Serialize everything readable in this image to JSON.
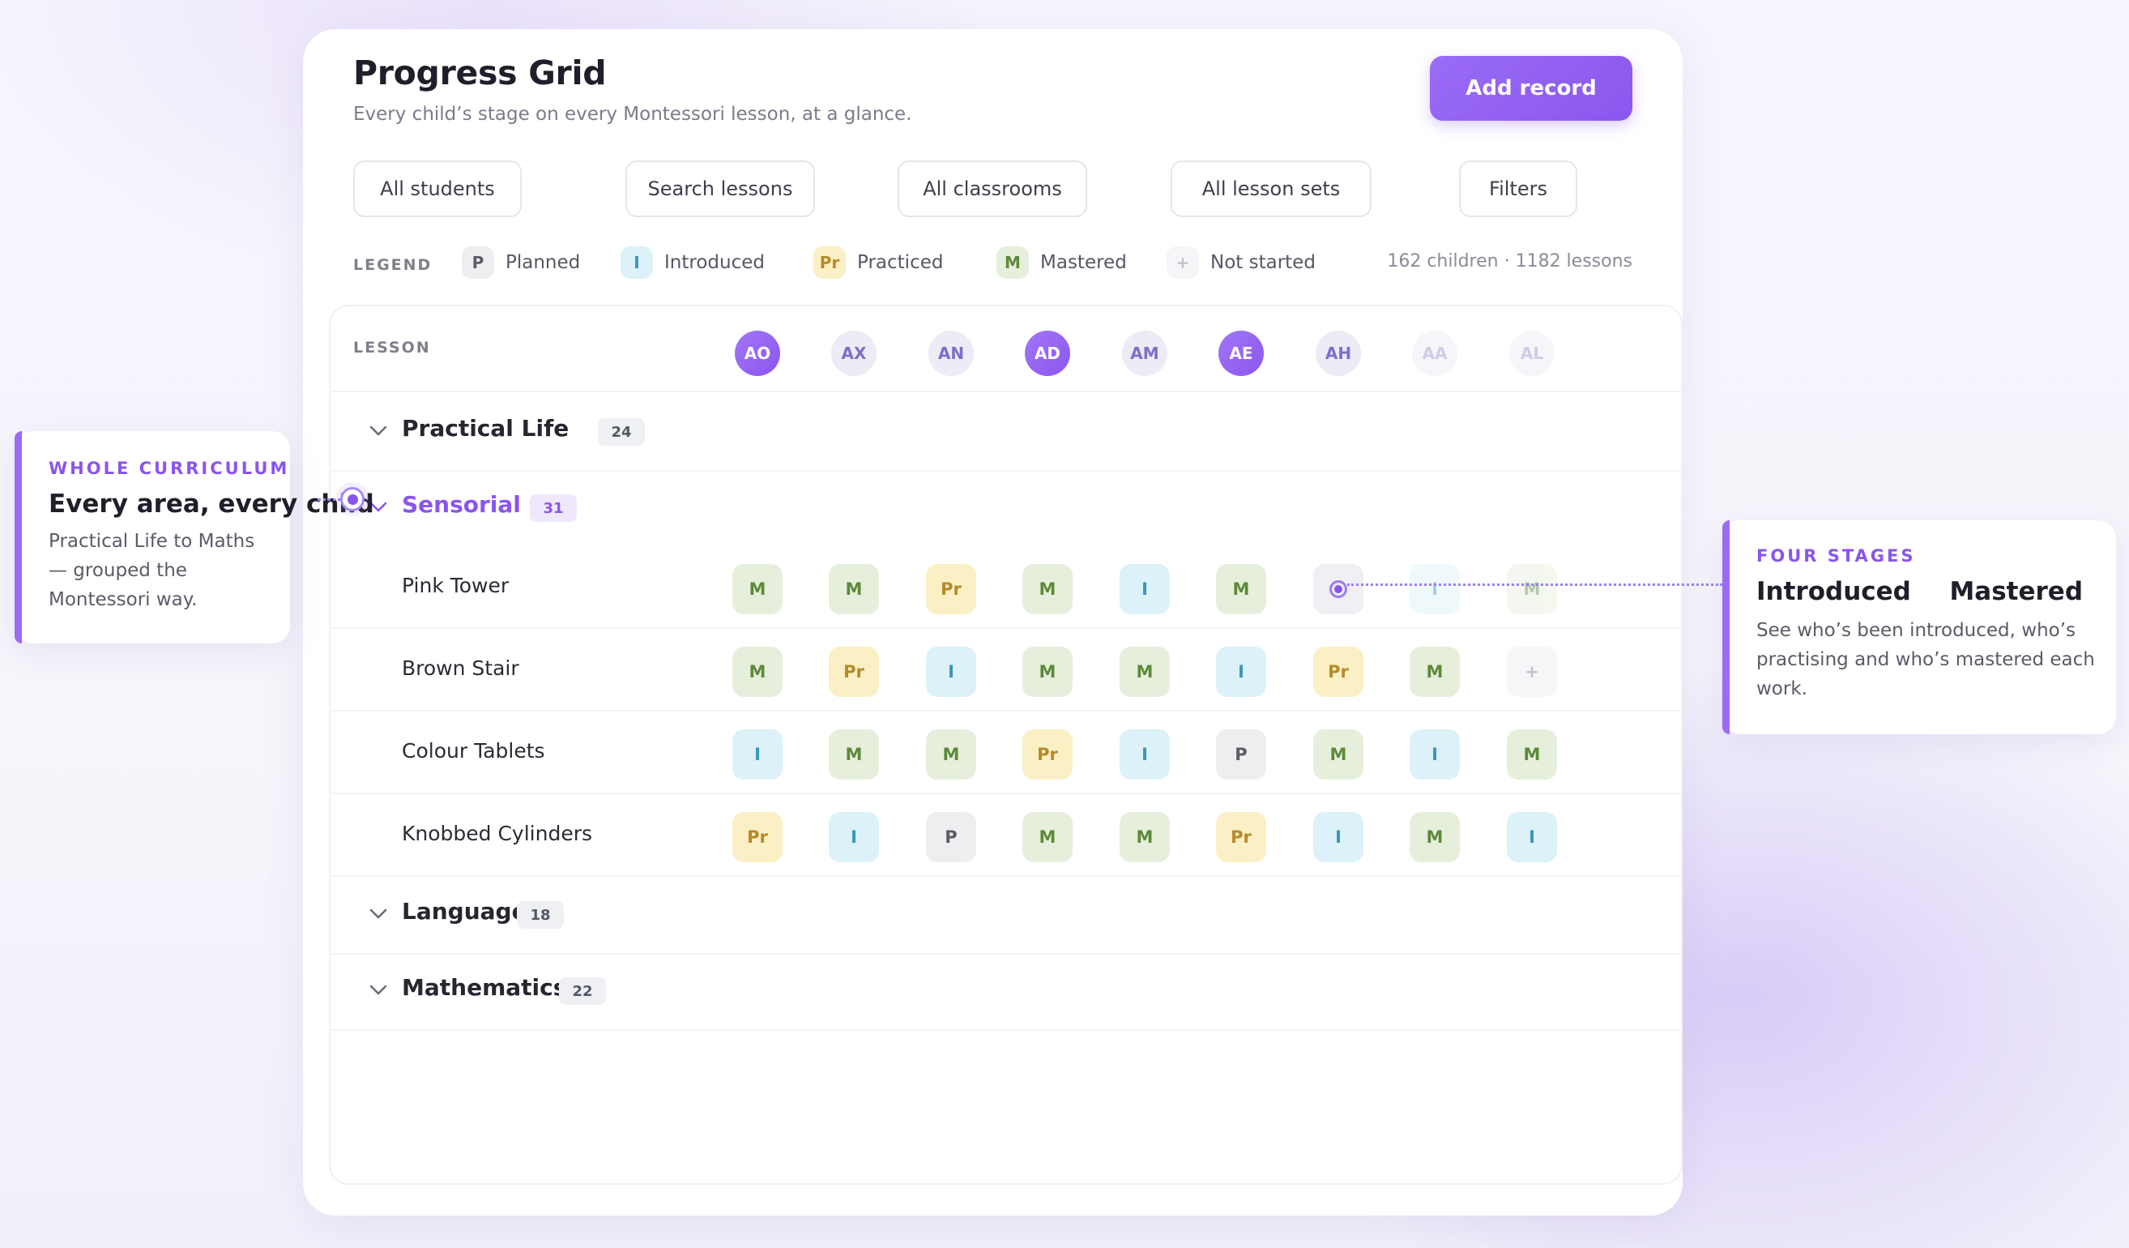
{
  "header": {
    "title": "Progress Grid",
    "subtitle": "Every child’s stage on every Montessori lesson, at a glance.",
    "add_button": "Add record"
  },
  "filters": [
    "All students",
    "Search lessons",
    "All classrooms",
    "All lesson sets",
    "Filters"
  ],
  "legend": {
    "label": "LEGEND",
    "items": [
      {
        "code": "P",
        "label": "Planned"
      },
      {
        "code": "I",
        "label": "Introduced"
      },
      {
        "code": "Pr",
        "label": "Practiced"
      },
      {
        "code": "M",
        "label": "Mastered"
      },
      {
        "code": "+",
        "label": "Not started"
      }
    ],
    "stats": "162 children · 1182 lessons"
  },
  "grid": {
    "lesson_label": "LESSON",
    "students": [
      "AO",
      "AX",
      "AN",
      "AD",
      "AM",
      "AE",
      "AH",
      "AA",
      "AL"
    ],
    "groups": [
      {
        "name": "Practical Life",
        "count": "24"
      },
      {
        "name": "Sensorial",
        "count": "31"
      },
      {
        "name": "Language",
        "count": "18"
      },
      {
        "name": "Mathematics",
        "count": "22"
      }
    ],
    "lessons": [
      {
        "name": "Pink Tower",
        "stages": [
          "M",
          "M",
          "Pr",
          "M",
          "I",
          "M",
          "",
          "I",
          "M"
        ]
      },
      {
        "name": "Brown Stair",
        "stages": [
          "M",
          "Pr",
          "I",
          "M",
          "M",
          "I",
          "Pr",
          "M",
          "+"
        ]
      },
      {
        "name": "Colour Tablets",
        "stages": [
          "I",
          "M",
          "M",
          "Pr",
          "I",
          "P",
          "M",
          "I",
          "M"
        ]
      },
      {
        "name": "Knobbed Cylinders",
        "stages": [
          "Pr",
          "I",
          "P",
          "M",
          "M",
          "Pr",
          "I",
          "M",
          "I"
        ]
      }
    ]
  },
  "callouts": {
    "left": {
      "eyebrow": "WHOLE CURRICULUM",
      "title": "Every area, every child",
      "body": "Practical Life to Maths — grouped the Montessori way."
    },
    "right": {
      "eyebrow": "FOUR STAGES",
      "title_a": "Introduced",
      "title_b": "Mastered",
      "body": "See who’s been introduced, who’s practising and who’s mastered each work."
    }
  },
  "colors": {
    "accent": "#8b56ee",
    "mastered": "#e6efdc",
    "practiced": "#fbf0c5",
    "introduced": "#dcf1f8",
    "planned": "#eeeef1"
  }
}
